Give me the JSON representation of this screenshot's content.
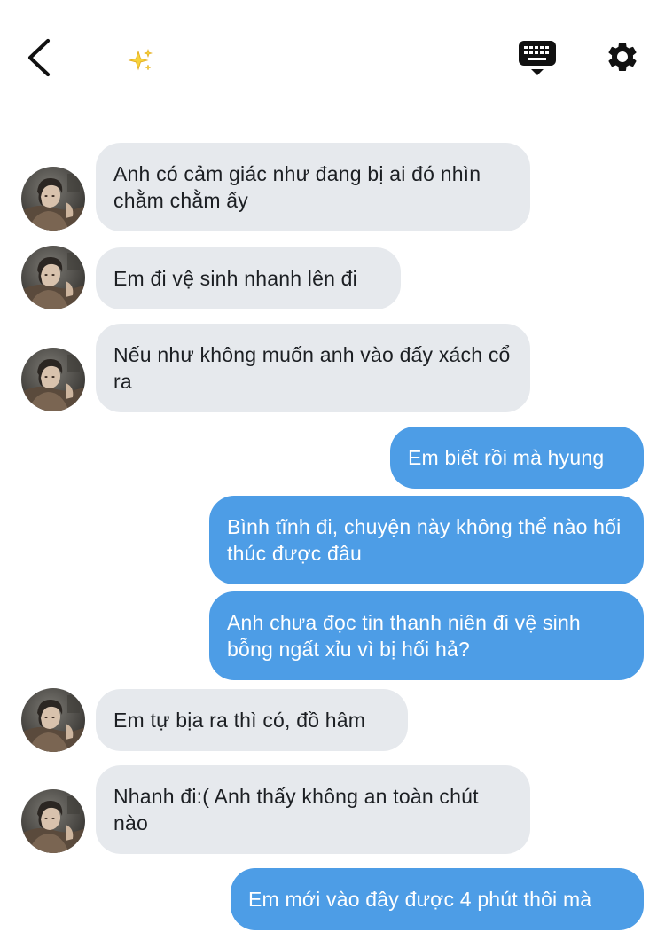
{
  "header": {
    "back_icon": "chevron-left-icon",
    "sparkle_icon": "sparkles-icon",
    "keyboard_icon": "keyboard-icon",
    "settings_icon": "gear-icon"
  },
  "colors": {
    "incoming_bubble": "#e6e9ed",
    "outgoing_bubble": "#4d9de6",
    "incoming_text": "#1c1f23",
    "outgoing_text": "#ffffff"
  },
  "messages": [
    {
      "side": "in",
      "text": "Anh có cảm giác như đang bị ai đó nhìn chằm chằm ấy"
    },
    {
      "side": "in",
      "text": "Em đi vệ sinh nhanh lên đi"
    },
    {
      "side": "in",
      "text": "Nếu như không muốn anh vào đấy xách cổ ra"
    },
    {
      "side": "out",
      "text": "Em biết rồi mà hyung"
    },
    {
      "side": "out",
      "text": "Bình tĩnh đi, chuyện này không thể nào hối thúc được đâu"
    },
    {
      "side": "out",
      "text": "Anh chưa đọc tin thanh niên đi vệ sinh bỗng ngất xỉu vì bị hối hả?"
    },
    {
      "side": "in",
      "text": "Em tự bịa ra thì có, đồ hâm"
    },
    {
      "side": "in",
      "text": "Nhanh đi:( Anh thấy không an toàn chút nào"
    },
    {
      "side": "out",
      "text": "Em mới vào đây được 4 phút thôi mà"
    }
  ]
}
